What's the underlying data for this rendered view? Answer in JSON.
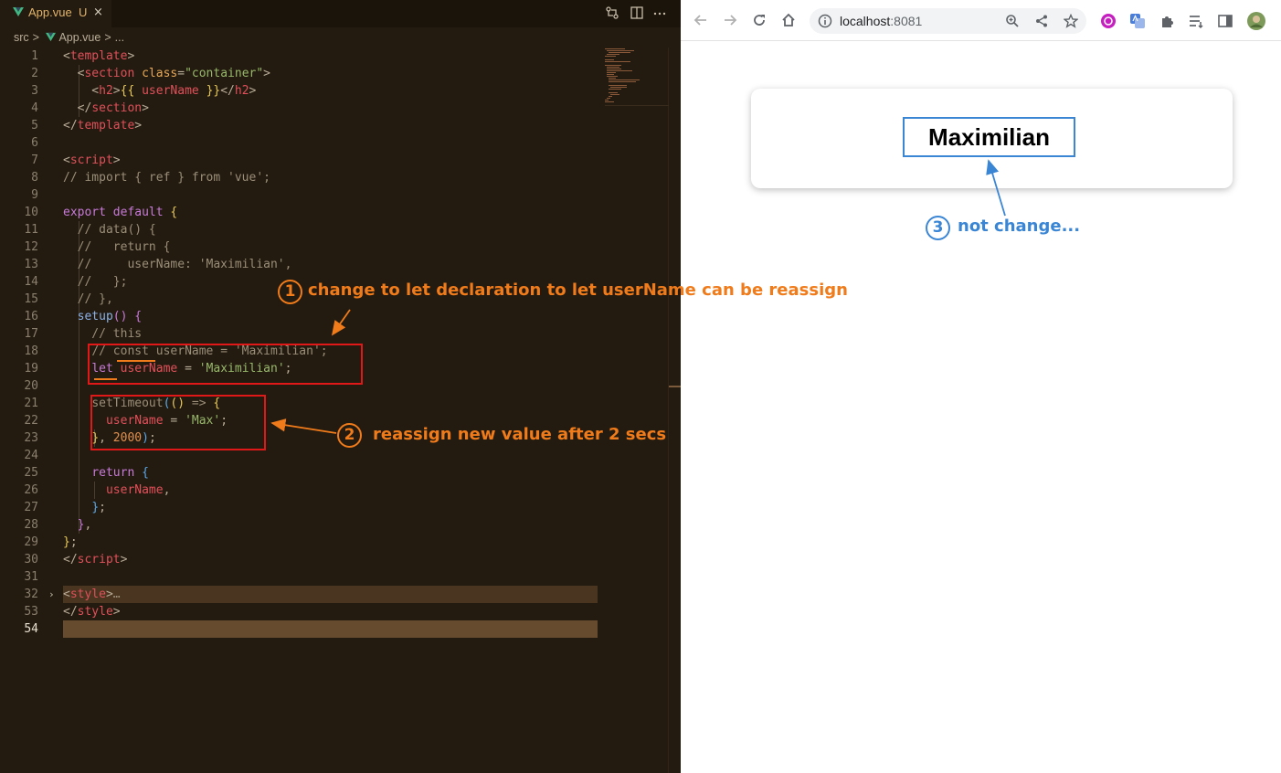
{
  "editor": {
    "tab": {
      "file_name": "App.vue",
      "status": "U",
      "close": "×"
    },
    "breadcrumb": {
      "folder": "src",
      "file": "App.vue",
      "ellipsis": "..."
    },
    "lines": [
      {
        "n": "1"
      },
      {
        "n": "2"
      },
      {
        "n": "3"
      },
      {
        "n": "4"
      },
      {
        "n": "5"
      },
      {
        "n": "6"
      },
      {
        "n": "7"
      },
      {
        "n": "8"
      },
      {
        "n": "9"
      },
      {
        "n": "10"
      },
      {
        "n": "11"
      },
      {
        "n": "12"
      },
      {
        "n": "13"
      },
      {
        "n": "14"
      },
      {
        "n": "15"
      },
      {
        "n": "16"
      },
      {
        "n": "17"
      },
      {
        "n": "18"
      },
      {
        "n": "19"
      },
      {
        "n": "20"
      },
      {
        "n": "21"
      },
      {
        "n": "22"
      },
      {
        "n": "23"
      },
      {
        "n": "24"
      },
      {
        "n": "25"
      },
      {
        "n": "26"
      },
      {
        "n": "27"
      },
      {
        "n": "28"
      },
      {
        "n": "29"
      },
      {
        "n": "30"
      },
      {
        "n": "31"
      },
      {
        "n": "32"
      },
      {
        "n": "53"
      },
      {
        "n": "54"
      }
    ],
    "code": {
      "l1": [
        "<",
        "template",
        ">"
      ],
      "l2": [
        "  <",
        "section",
        " ",
        "class",
        "=",
        "\"container\"",
        ">"
      ],
      "l3": [
        "    <",
        "h2",
        ">",
        "{{",
        " ",
        "userName",
        " ",
        "}}",
        "</",
        "h2",
        ">"
      ],
      "l4": [
        "  </",
        "section",
        ">"
      ],
      "l5": [
        "</",
        "template",
        ">"
      ],
      "l7": [
        "<",
        "script",
        ">"
      ],
      "l8": "// import { ref } from 'vue';",
      "l10": [
        "export",
        " ",
        "default",
        " ",
        "{"
      ],
      "l11": "  // data() {",
      "l12": "  //   return {",
      "l13": "  //     userName: 'Maximilian',",
      "l14": "  //   };",
      "l15": "  // },",
      "l16": [
        "  ",
        "setup",
        "() ",
        "{"
      ],
      "l17": "    // this",
      "l18": [
        "    ",
        "// ",
        "const",
        " userName = 'Maximilian';"
      ],
      "l19": [
        "    ",
        "let",
        " ",
        "userName",
        " = ",
        "'Maximilian'",
        ";"
      ],
      "l21": [
        "    ",
        "setTimeout",
        "(",
        "()",
        " => ",
        "{"
      ],
      "l22": [
        "      ",
        "userName",
        " = ",
        "'Max'",
        ";"
      ],
      "l23": [
        "    ",
        "}",
        ", ",
        "2000",
        ")",
        ";"
      ],
      "l25": [
        "    ",
        "return",
        " ",
        "{"
      ],
      "l26": [
        "      ",
        "userName",
        ","
      ],
      "l27": [
        "    ",
        "}",
        ";"
      ],
      "l28": [
        "  ",
        "}",
        ","
      ],
      "l29": [
        "",
        "}",
        ";"
      ],
      "l30": [
        "</",
        "script",
        ">"
      ],
      "l32": [
        "<",
        "style",
        ">",
        "…"
      ],
      "l53": [
        "</",
        "style",
        ">"
      ]
    }
  },
  "browser": {
    "url_host": "localhost",
    "url_port": ":8081",
    "page_heading": "Maximilian"
  },
  "annotations": {
    "a1": {
      "number": "1",
      "text": "change to let declaration to let userName can be reassign"
    },
    "a2": {
      "number": "2",
      "text": "reassign new value after 2 secs"
    },
    "a3": {
      "number": "3",
      "text": "not change..."
    }
  },
  "colors": {
    "annotation_orange": "#f07b1a",
    "annotation_blue": "#3b86d4",
    "highlight_red": "#e01818",
    "editor_bg": "#241b10"
  }
}
